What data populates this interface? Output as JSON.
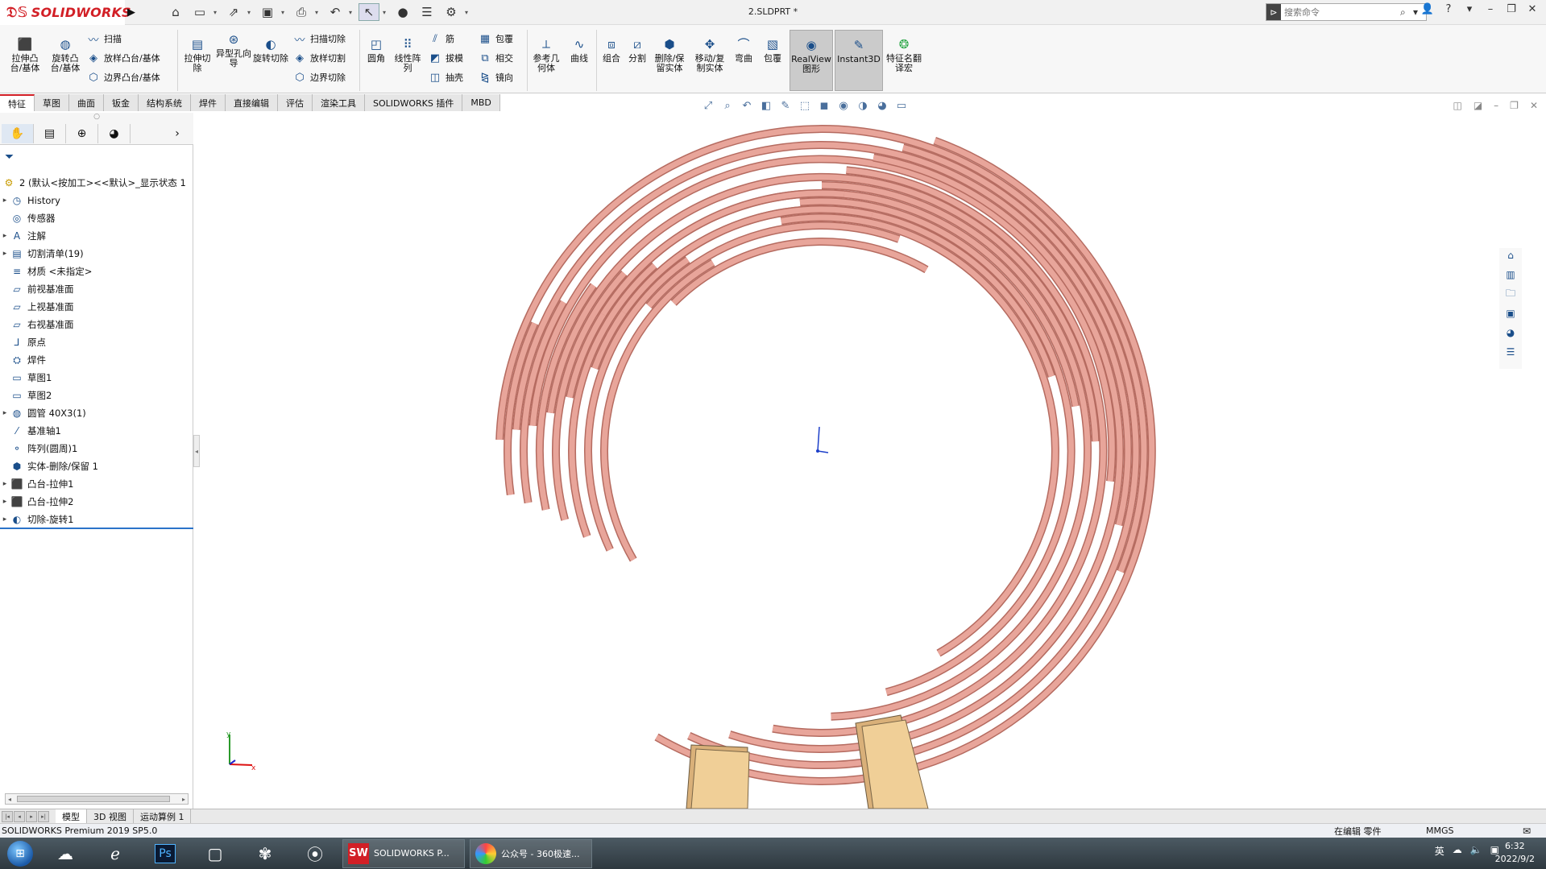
{
  "app": {
    "brand": "SOLIDWORKS",
    "doc_title": "2.SLDPRT *"
  },
  "search": {
    "placeholder": "搜索命令"
  },
  "ribbon": {
    "extrude_boss": "拉伸凸台/基体",
    "revolve_boss": "旋转凸台/基体",
    "sweep": "扫描",
    "loft": "放样凸台/基体",
    "boundary_boss": "边界凸台/基体",
    "extrude_cut": "拉伸切除",
    "hole_wizard": "异型孔向导",
    "revolve_cut": "旋转切除",
    "sweep_cut": "扫描切除",
    "loft_cut": "放样切割",
    "boundary_cut": "边界切除",
    "fillet": "圆角",
    "linear_pattern": "线性阵列",
    "rib": "筋",
    "draft": "拔模",
    "shell": "抽壳",
    "wrap": "包覆",
    "intersect": "相交",
    "mirror": "镜向",
    "ref_geometry": "参考几何体",
    "curves": "曲线",
    "combine": "组合",
    "split": "分割",
    "delete_keep": "删除/保留实体",
    "move_copy": "移动/复制实体",
    "flex": "弯曲",
    "wrap2": "包覆",
    "realview": "RealView图形",
    "instant3d": "Instant3D",
    "feature_translate": "特征名翻译宏"
  },
  "tabs": [
    "特征",
    "草图",
    "曲面",
    "钣金",
    "结构系统",
    "焊件",
    "直接编辑",
    "评估",
    "渲染工具",
    "SOLIDWORKS 插件",
    "MBD"
  ],
  "tree": {
    "root": "2  (默认<按加工><<默认>_显示状态 1",
    "items": [
      {
        "label": "History",
        "expand": "▸",
        "icon": "history-icon"
      },
      {
        "label": "传感器",
        "expand": "",
        "icon": "sensor-icon"
      },
      {
        "label": "注解",
        "expand": "▸",
        "icon": "annotation-icon"
      },
      {
        "label": "切割清单(19)",
        "expand": "▸",
        "icon": "cut-list-icon"
      },
      {
        "label": "材质 <未指定>",
        "expand": "",
        "icon": "material-icon"
      },
      {
        "label": "前视基准面",
        "expand": "",
        "icon": "plane-icon"
      },
      {
        "label": "上视基准面",
        "expand": "",
        "icon": "plane-icon"
      },
      {
        "label": "右视基准面",
        "expand": "",
        "icon": "plane-icon"
      },
      {
        "label": "原点",
        "expand": "",
        "icon": "origin-icon"
      },
      {
        "label": "焊件",
        "expand": "",
        "icon": "weldment-icon"
      },
      {
        "label": "草图1",
        "expand": "",
        "icon": "sketch-icon"
      },
      {
        "label": "草图2",
        "expand": "",
        "icon": "sketch-icon"
      },
      {
        "label": "圆管 40X3(1)",
        "expand": "▸",
        "icon": "pipe-icon"
      },
      {
        "label": "基准轴1",
        "expand": "",
        "icon": "axis-icon"
      },
      {
        "label": "阵列(圆周)1",
        "expand": "",
        "icon": "pattern-icon"
      },
      {
        "label": "实体-删除/保留 1",
        "expand": "",
        "icon": "body-icon"
      },
      {
        "label": "凸台-拉伸1",
        "expand": "▸",
        "icon": "extrude-icon"
      },
      {
        "label": "凸台-拉伸2",
        "expand": "▸",
        "icon": "extrude-icon"
      },
      {
        "label": "切除-旋转1",
        "expand": "▸",
        "icon": "revolve-cut-icon"
      }
    ]
  },
  "bottom_tabs": [
    "模型",
    "3D 视图",
    "运动算例 1"
  ],
  "status": {
    "version": "SOLIDWORKS Premium 2019 SP5.0",
    "mode": "在编辑 零件",
    "units": "MMGS"
  },
  "taskbar": {
    "apps": [
      {
        "label": "SOLIDWORKS P...",
        "icon": "solidworks-icon"
      },
      {
        "label": "公众号 - 360极速...",
        "icon": "browser-icon"
      }
    ],
    "time": "6:32",
    "date": "2022/9/2"
  },
  "colors": {
    "pipe": "#e8a59a",
    "pipe_edge": "#b56b60",
    "wood": "#e8c48a",
    "brand": "#d21f26"
  }
}
